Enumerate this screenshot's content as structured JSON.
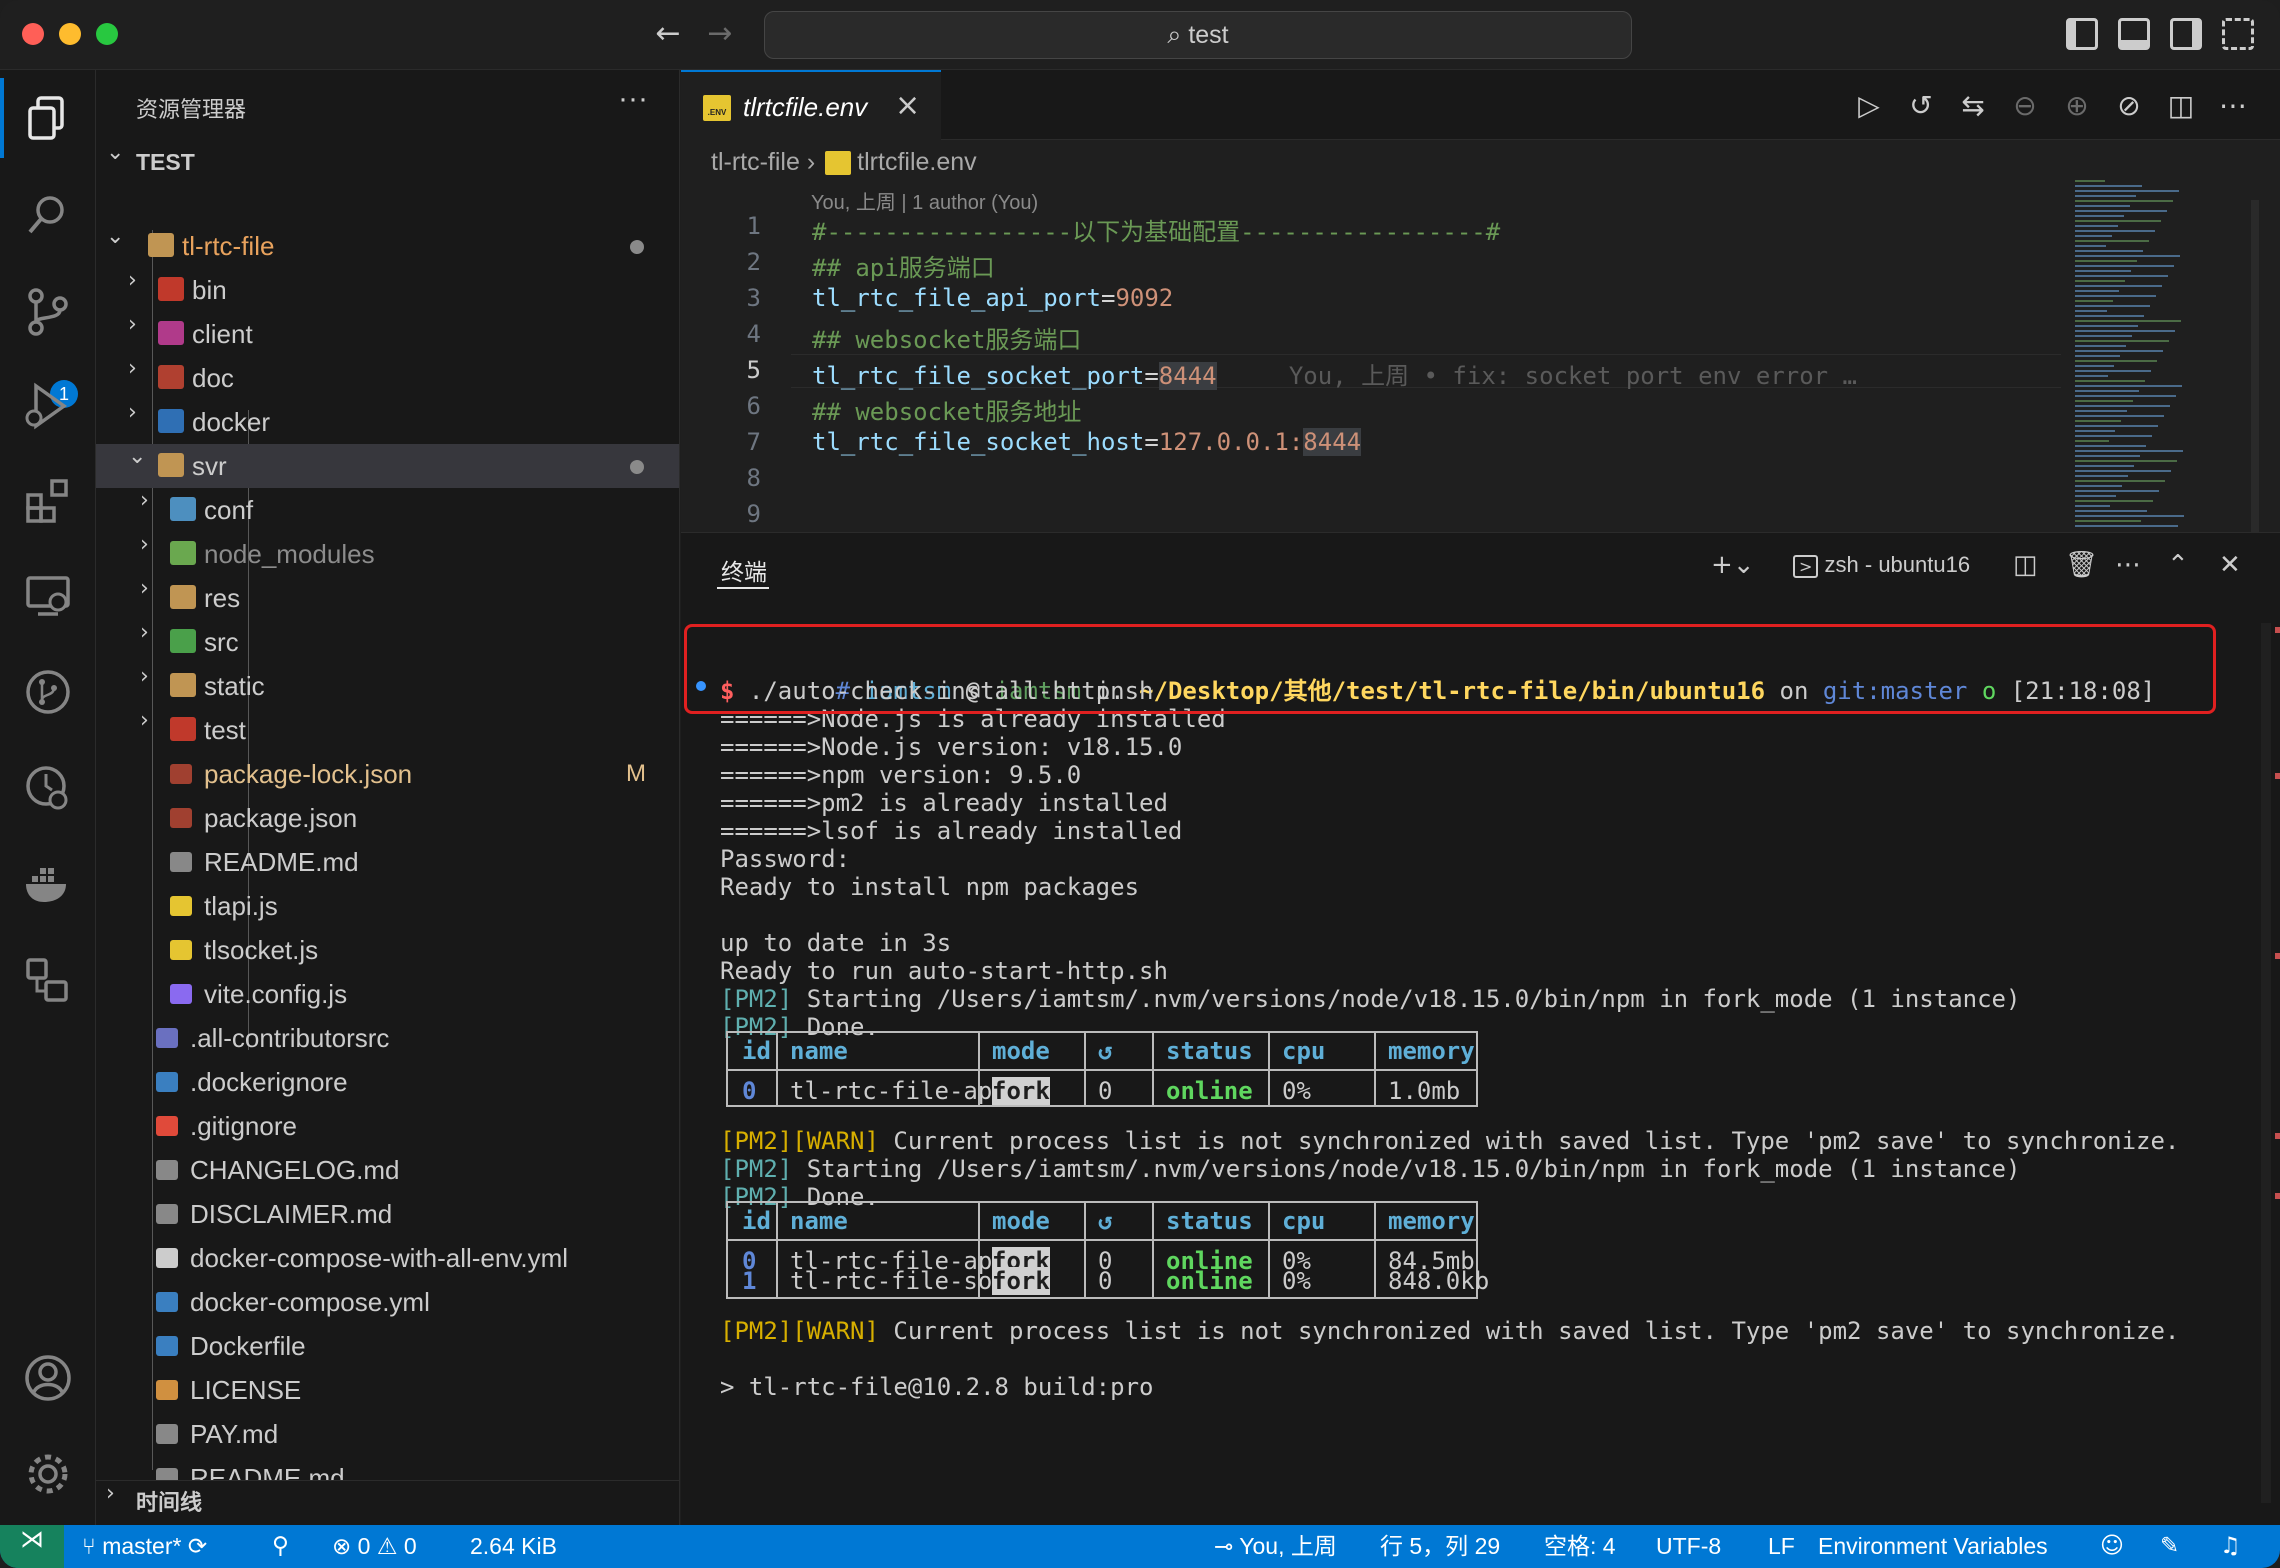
{
  "titlebar": {
    "search_text": "test"
  },
  "explorer": {
    "title": "资源管理器",
    "more": "···",
    "root": "TEST",
    "items": [
      {
        "label": "tl-rtc-file",
        "type": "folder-open",
        "color": "#e8a25d",
        "dot": true
      },
      {
        "label": "bin",
        "type": "folder",
        "color": "#cccccc"
      },
      {
        "label": "client",
        "type": "folder",
        "color": "#cccccc"
      },
      {
        "label": "doc",
        "type": "folder",
        "color": "#cccccc"
      },
      {
        "label": "docker",
        "type": "folder",
        "color": "#cccccc"
      },
      {
        "label": "svr",
        "type": "folder-open",
        "color": "#cccccc",
        "dot": true
      },
      {
        "label": "conf",
        "type": "folder",
        "color": "#cccccc"
      },
      {
        "label": "node_modules",
        "type": "folder",
        "color": "#8c8c8c"
      },
      {
        "label": "res",
        "type": "folder",
        "color": "#cccccc"
      },
      {
        "label": "src",
        "type": "folder",
        "color": "#cccccc"
      },
      {
        "label": "static",
        "type": "folder",
        "color": "#cccccc"
      },
      {
        "label": "test",
        "type": "folder",
        "color": "#cccccc"
      },
      {
        "label": "package-lock.json",
        "type": "file",
        "color": "#e2c08d",
        "git": "M"
      },
      {
        "label": "package.json",
        "type": "file",
        "color": "#cccccc"
      },
      {
        "label": "README.md",
        "type": "file",
        "color": "#cccccc"
      },
      {
        "label": "tlapi.js",
        "type": "file",
        "color": "#cccccc"
      },
      {
        "label": "tlsocket.js",
        "type": "file",
        "color": "#cccccc"
      },
      {
        "label": "vite.config.js",
        "type": "file",
        "color": "#cccccc"
      },
      {
        "label": ".all-contributorsrc",
        "type": "file",
        "color": "#cccccc"
      },
      {
        "label": ".dockerignore",
        "type": "file",
        "color": "#cccccc"
      },
      {
        "label": ".gitignore",
        "type": "file",
        "color": "#cccccc"
      },
      {
        "label": "CHANGELOG.md",
        "type": "file",
        "color": "#cccccc"
      },
      {
        "label": "DISCLAIMER.md",
        "type": "file",
        "color": "#cccccc"
      },
      {
        "label": "docker-compose-with-all-env.yml",
        "type": "file",
        "color": "#cccccc"
      },
      {
        "label": "docker-compose.yml",
        "type": "file",
        "color": "#cccccc"
      },
      {
        "label": "Dockerfile",
        "type": "file",
        "color": "#cccccc"
      },
      {
        "label": "LICENSE",
        "type": "file",
        "color": "#cccccc"
      },
      {
        "label": "PAY.md",
        "type": "file",
        "color": "#cccccc"
      },
      {
        "label": "README.md",
        "type": "file",
        "color": "#cccccc"
      }
    ],
    "timeline": "时间线",
    "scm_badge": "1"
  },
  "editor": {
    "tab": "tlrtcfile.env",
    "tab_icon": ".ENV",
    "breadcrumb_folder": "tl-rtc-file",
    "breadcrumb_file": "tlrtcfile.env",
    "blame_header": "You, 上周 | 1 author (You)",
    "lines": [
      {
        "n": "1",
        "text": "#-----------------以下为基础配置-----------------#"
      },
      {
        "n": "2",
        "text": "## api服务端口"
      },
      {
        "n": "3",
        "key": "tl_rtc_file_api_port",
        "value": "9092"
      },
      {
        "n": "4",
        "text": "## websocket服务端口"
      },
      {
        "n": "5",
        "key": "tl_rtc_file_socket_port",
        "value": "8444",
        "ghost": "You, 上周 • fix: socket port env error …"
      },
      {
        "n": "6",
        "text": "## websocket服务地址"
      },
      {
        "n": "7",
        "key": "tl_rtc_file_socket_host",
        "value": "127.0.0.1:",
        "value_hl": "8444"
      },
      {
        "n": "8",
        "text": ""
      },
      {
        "n": "9",
        "text": ""
      }
    ]
  },
  "panel": {
    "tab": "终端",
    "shell": "zsh - ubuntu16",
    "prompt": {
      "hash": "#",
      "user": "iamtsm",
      "at": "@",
      "host": "iamtsm",
      "in": "in",
      "path": "~/Desktop/其他/test/tl-rtc-file/bin/ubuntu16",
      "on": "on",
      "git": "git:master",
      "circle": "o",
      "time": "[21:18:08]",
      "dollar": "$",
      "command": "./auto-check-install-http.sh"
    },
    "out1": [
      "======>Node.js is already installed",
      "======>Node.js version: v18.15.0",
      "======>npm version: 9.5.0",
      "======>pm2 is already installed",
      "======>lsof is already installed",
      "Password:",
      "Ready to install npm packages",
      "",
      "up to date in 3s",
      "Ready to run auto-start-http.sh"
    ],
    "pm2_tag": "[PM2]",
    "warn_tag": "[WARN]",
    "pm2_start": " Starting /Users/iamtsm/.nvm/versions/node/v18.15.0/bin/npm in fork_mode (1 instance)",
    "pm2_done": " Done.",
    "warn_msg": " Current process list is not synchronized with saved list. Type 'pm2 save' to synchronize.",
    "table_headers": [
      "id",
      "name",
      "mode",
      "↺",
      "status",
      "cpu",
      "memory"
    ],
    "table1": [
      [
        "0",
        "tl-rtc-file-api",
        "fork",
        "0",
        "online",
        "0%",
        "1.0mb"
      ]
    ],
    "table2": [
      [
        "0",
        "tl-rtc-file-api",
        "fork",
        "0",
        "online",
        "0%",
        "84.5mb"
      ],
      [
        "1",
        "tl-rtc-file-socket",
        "fork",
        "0",
        "online",
        "0%",
        "848.0kb"
      ]
    ],
    "last_line": "> tl-rtc-file@10.2.8 build:pro"
  },
  "statusbar": {
    "branch": "master*",
    "errors": "0",
    "warnings": "0",
    "size": "2.64 KiB",
    "blame": "You, 上周",
    "position": "行 5，列 29",
    "spaces": "空格: 4",
    "encoding": "UTF-8",
    "eol": "LF",
    "language": "Environment Variables"
  },
  "colors": {
    "accent": "#0078d4",
    "status_bg": "#0078d4",
    "highlight_box": "#e02020"
  }
}
